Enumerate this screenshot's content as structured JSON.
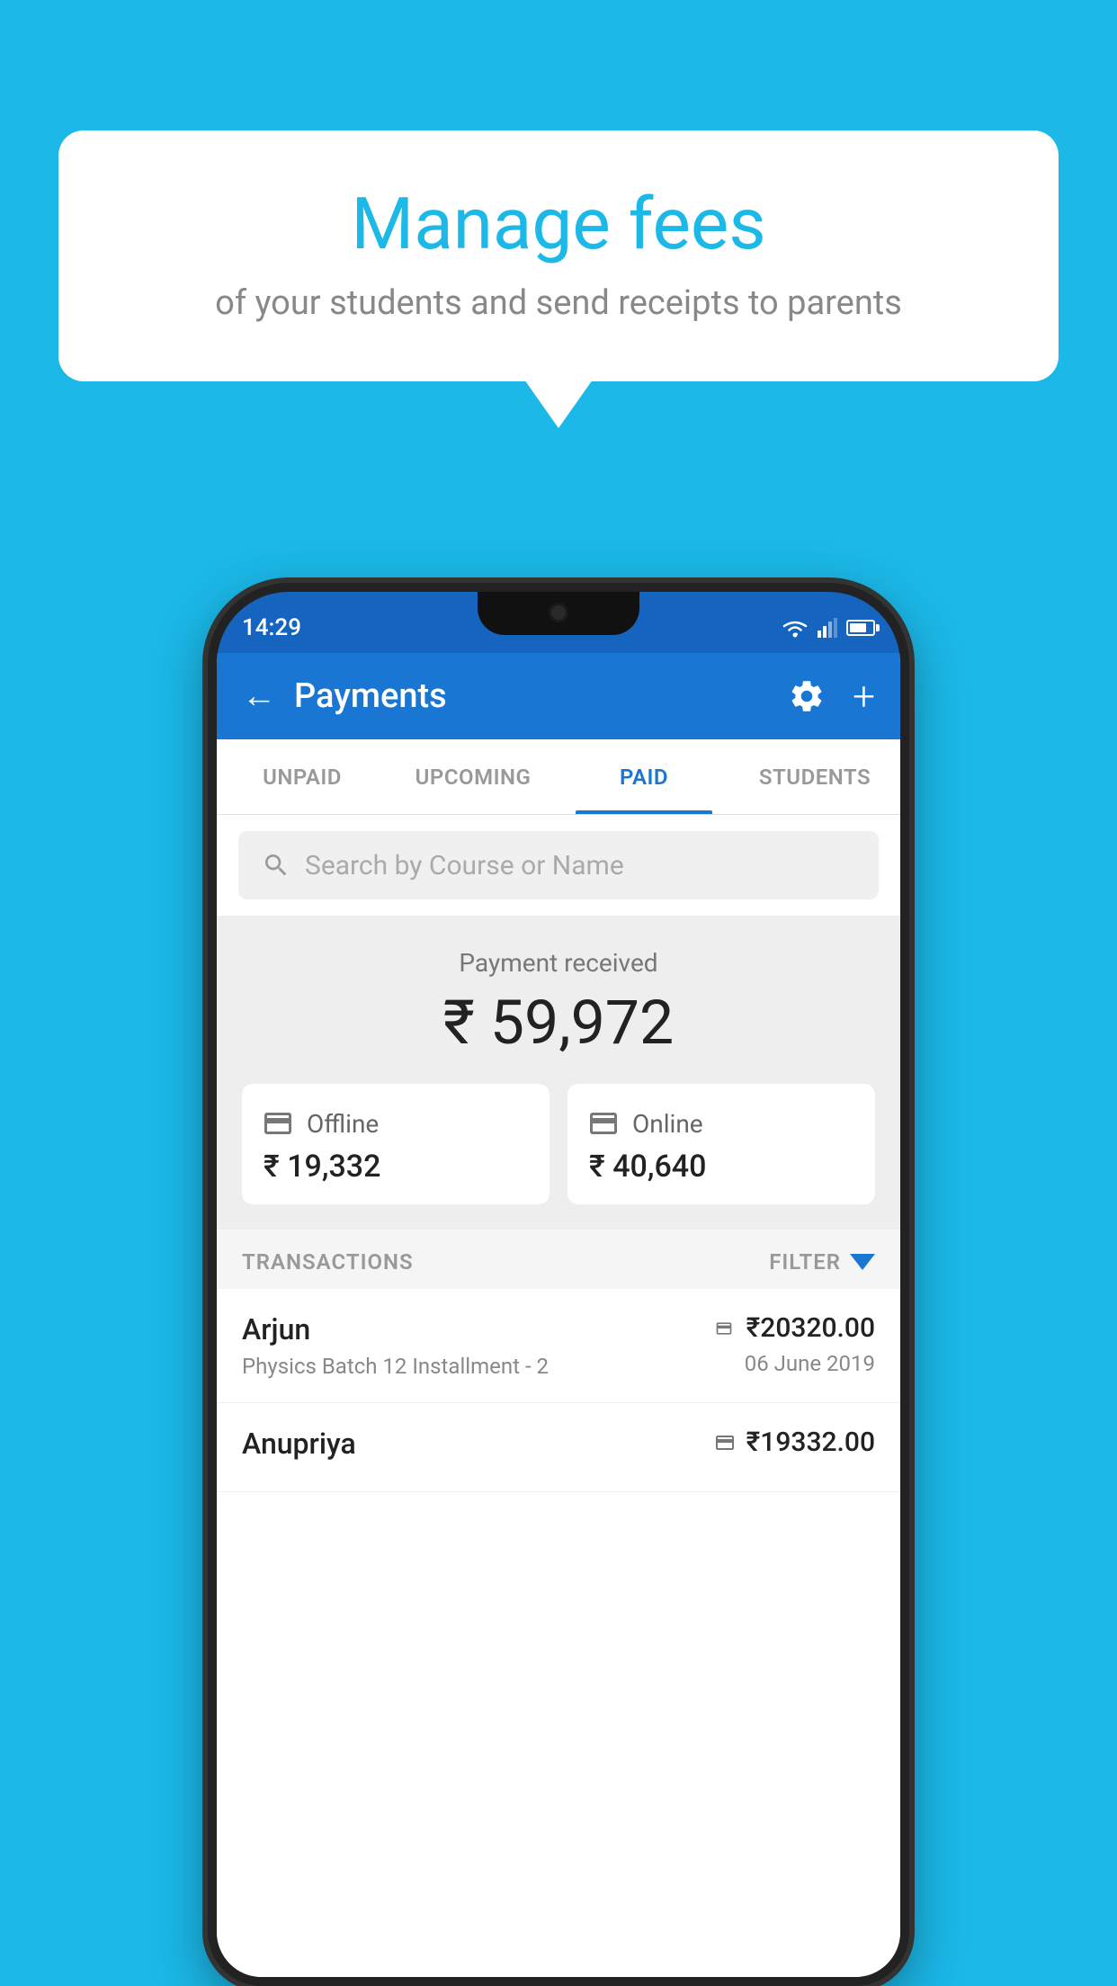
{
  "background_color": "#1BB8E8",
  "speech_bubble": {
    "title": "Manage fees",
    "subtitle": "of your students and send receipts to parents"
  },
  "status_bar": {
    "time": "14:29"
  },
  "app_header": {
    "title": "Payments",
    "back_label": "←"
  },
  "tabs": [
    {
      "id": "unpaid",
      "label": "UNPAID",
      "active": false
    },
    {
      "id": "upcoming",
      "label": "UPCOMING",
      "active": false
    },
    {
      "id": "paid",
      "label": "PAID",
      "active": true
    },
    {
      "id": "students",
      "label": "STUDENTS",
      "active": false
    }
  ],
  "search": {
    "placeholder": "Search by Course or Name"
  },
  "payment_summary": {
    "label": "Payment received",
    "total": "₹ 59,972",
    "offline_label": "Offline",
    "offline_amount": "₹ 19,332",
    "online_label": "Online",
    "online_amount": "₹ 40,640"
  },
  "transactions_section": {
    "label": "TRANSACTIONS",
    "filter_label": "FILTER"
  },
  "transactions": [
    {
      "name": "Arjun",
      "detail": "Physics Batch 12 Installment - 2",
      "amount": "₹20320.00",
      "date": "06 June 2019",
      "payment_type": "card"
    },
    {
      "name": "Anupriya",
      "detail": "",
      "amount": "₹19332.00",
      "date": "",
      "payment_type": "cash"
    }
  ]
}
